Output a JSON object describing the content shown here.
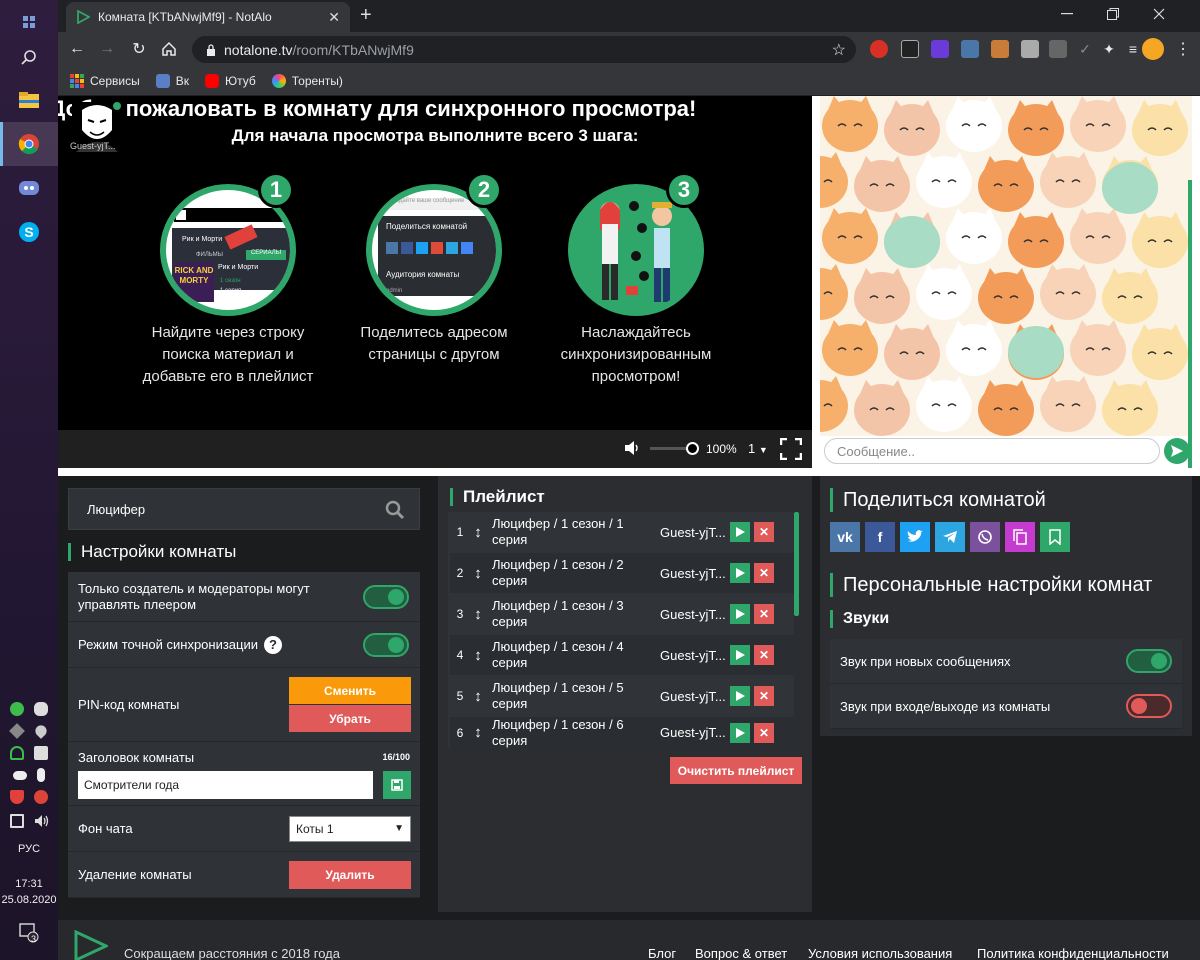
{
  "taskbar": {
    "lang": "РУС",
    "time": "17:31",
    "date": "25.08.2020",
    "notif_count": "3"
  },
  "browser": {
    "tab_title": "Комната [KTbANwjMf9] - NotAlo",
    "url_host": "notalone.tv",
    "url_path": "/room/KTbANwjMf9",
    "bookmarks": [
      "Сервисы",
      "Вк",
      "Ютуб",
      "Торенты)"
    ]
  },
  "video": {
    "heading": "Добро пожаловать в комнату для синхронного просмотра!",
    "subheading": "Для начала просмотра выполните всего 3 шага:",
    "guest_label": "Guest-yjT...",
    "steps": [
      {
        "num": "1",
        "caption": [
          "Найдите через строку",
          "поиска материал и",
          "добавьте его в плейлист"
        ],
        "inner": {
          "tab1": "Рик и Морти",
          "tab2": "ФИЛЬМЫ",
          "tab3": "СЕРИАЛЫ",
          "card": "Рик и Морти",
          "season": "1 сезон",
          "episode": "1 серия",
          "poster": "RICK AND MORTY"
        }
      },
      {
        "num": "2",
        "caption": [
          "Поделитесь адресом",
          "страницы с другом"
        ],
        "inner": {
          "line1": "Голодайте ваше сообщение",
          "line2": "Поделиться комнатой",
          "line3": "Аудитория комнаты",
          "line4": "admin"
        }
      },
      {
        "num": "3",
        "caption": [
          "Наслаждайтесь",
          "синхронизированным",
          "просмотром!"
        ]
      }
    ],
    "volume": "100%",
    "speed": "1"
  },
  "chat": {
    "placeholder": "Сообщение.."
  },
  "search": {
    "value": "Люцифер"
  },
  "room_settings": {
    "title": "Настройки комнаты",
    "only_creator": "Только создатель и модераторы могут управлять плеером",
    "precise_sync": "Режим точной синхронизации",
    "pin_label": "PIN-код комнаты",
    "pin_change": "Сменить",
    "pin_remove": "Убрать",
    "room_title_label": "Заголовок комнаты",
    "room_title_count": "16/100",
    "room_title_value": "Смотрители года",
    "chat_bg_label": "Фон чата",
    "chat_bg_value": "Коты 1",
    "delete_label": "Удаление комнаты",
    "delete_btn": "Удалить"
  },
  "playlist": {
    "title": "Плейлист",
    "items": [
      {
        "num": "1",
        "title": "Люцифер / 1 сезон / 1 серия",
        "guest": "Guest-yjT..."
      },
      {
        "num": "2",
        "title": "Люцифер / 1 сезон / 2 серия",
        "guest": "Guest-yjT..."
      },
      {
        "num": "3",
        "title": "Люцифер / 1 сезон / 3 серия",
        "guest": "Guest-yjT..."
      },
      {
        "num": "4",
        "title": "Люцифер / 1 сезон / 4 серия",
        "guest": "Guest-yjT..."
      },
      {
        "num": "5",
        "title": "Люцифер / 1 сезон / 5 серия",
        "guest": "Guest-yjT..."
      },
      {
        "num": "6",
        "title": "Люцифер / 1 сезон / 6 серия",
        "guest": "Guest-yjT..."
      }
    ],
    "clear_btn": "Очистить плейлист"
  },
  "share": {
    "title": "Поделиться комнатой",
    "personal_title": "Персональные настройки комнат",
    "sounds_title": "Звуки",
    "sound_messages": "Звук при новых сообщениях",
    "sound_join": "Звук при входе/выходе из комнаты"
  },
  "footer": {
    "tagline": "Сокращаем расстояния с 2018 года",
    "links": [
      "Блог",
      "Вопрос & ответ",
      "Условия использования",
      "Политика конфиденциальности"
    ]
  },
  "colors": {
    "accent": "#2fa66a",
    "orange": "#fa9a0a",
    "red": "#e05a5a",
    "panel": "#2b2d31",
    "bg": "#1b1c1e"
  }
}
